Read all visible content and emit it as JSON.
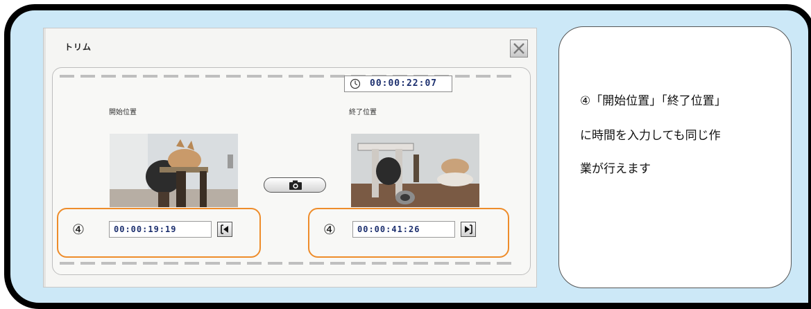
{
  "dialog": {
    "title": "トリム",
    "close_icon": "close-x-icon",
    "duration": "00:00:22:07",
    "start_label": "開始位置",
    "end_label": "終了位置",
    "start_time": "00:00:19:19",
    "end_time": "00:00:41:26",
    "capture_icon": "camera-icon",
    "start_jump_icon": "jump-to-start-icon",
    "end_jump_icon": "jump-to-end-icon"
  },
  "annotation": {
    "marker": "④",
    "highlight_color": "#ee8c2a",
    "note_lines": [
      "④「開始位置」「終了位置」",
      "に時間を入力しても同じ作",
      "業が行えます"
    ]
  },
  "colors": {
    "frame_bg": "#cce8f7",
    "frame_border": "#000000",
    "time_text": "#1c2f6e"
  }
}
